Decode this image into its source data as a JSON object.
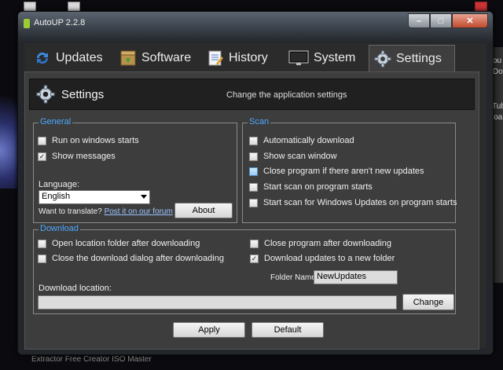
{
  "window": {
    "title": "AutoUP 2.2.8",
    "controls": {
      "minimize": "–",
      "maximize": "□",
      "close": "✕"
    }
  },
  "tabs": [
    {
      "label": "Updates",
      "icon": "refresh-icon"
    },
    {
      "label": "Software",
      "icon": "package-icon"
    },
    {
      "label": "History",
      "icon": "notepad-icon"
    },
    {
      "label": "System",
      "icon": "monitor-icon"
    },
    {
      "label": "Settings",
      "icon": "gear-icon",
      "active": true
    }
  ],
  "header": {
    "title": "Settings",
    "subtitle": "Change the application settings"
  },
  "general": {
    "legend": "General",
    "run_on_start": {
      "label": "Run on windows starts",
      "checked": false
    },
    "show_messages": {
      "label": "Show messages",
      "checked": true
    },
    "language_label": "Language:",
    "language_value": "English",
    "translate_text": "Want to translate?",
    "translate_link": "Post it on our forum",
    "about_button": "About"
  },
  "scan": {
    "legend": "Scan",
    "options": [
      {
        "label": "Automatically download",
        "checked": false
      },
      {
        "label": "Show scan window",
        "checked": false
      },
      {
        "label": "Close program if there aren't new updates",
        "checked": false
      },
      {
        "label": "Start scan on program starts",
        "checked": false
      },
      {
        "label": "Start scan for Windows Updates on program starts",
        "checked": false
      }
    ]
  },
  "download": {
    "legend": "Download",
    "open_folder": {
      "label": "Open location folder after downloading",
      "checked": false
    },
    "close_dialog": {
      "label": "Close the download dialog after downloading",
      "checked": false
    },
    "close_program": {
      "label": "Close program after downloading",
      "checked": false
    },
    "new_folder": {
      "label": "Download updates to a new folder",
      "checked": true
    },
    "folder_name_label": "Folder Name:",
    "folder_name_value": "NewUpdates",
    "location_label": "Download location:",
    "location_value": "",
    "change_button": "Change"
  },
  "footer": {
    "apply_button": "Apply",
    "default_button": "Default"
  },
  "desktop": {
    "right_texts": [
      "ou",
      "Do",
      "Tub",
      "loa"
    ],
    "bottom_text": "Extractor Free     Creator     ISO Master"
  }
}
